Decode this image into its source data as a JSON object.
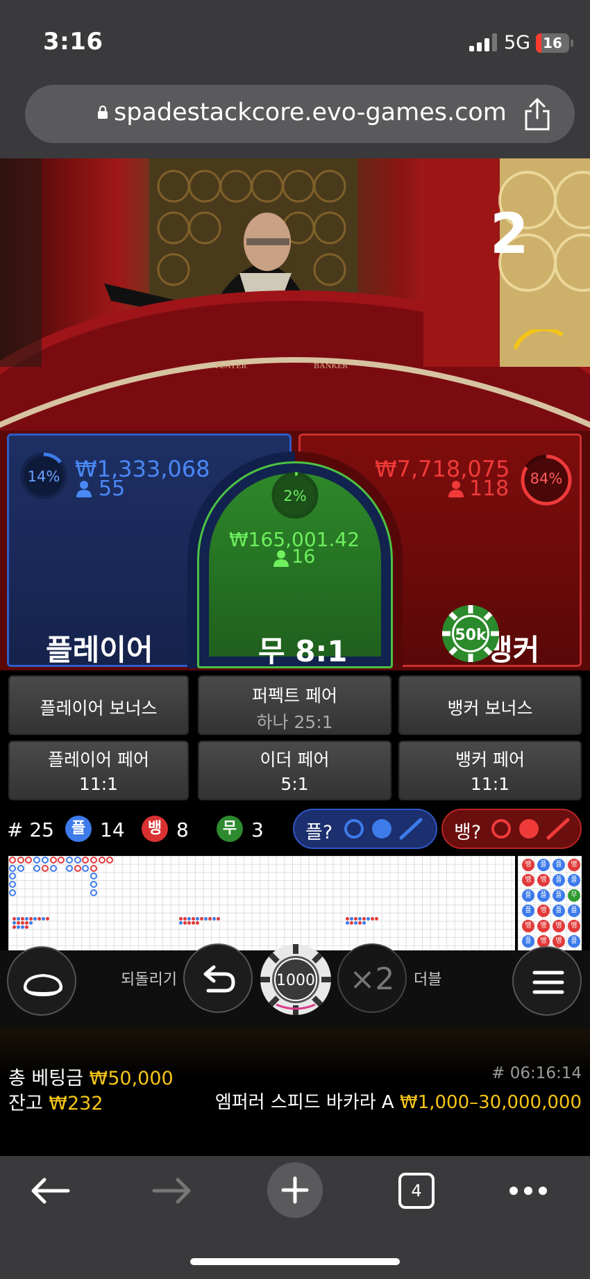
{
  "status_bar": {
    "time": "3:16",
    "network": "5G",
    "battery": "16"
  },
  "browser": {
    "url": "spadestackcore.evo-games.com",
    "tabs_count": "4"
  },
  "video": {
    "round_number": "2"
  },
  "bets": {
    "player": {
      "label": "플레이어",
      "percent": "14%",
      "percent_value": 14,
      "amount": "₩1,333,068",
      "players": "55",
      "color": "#3d7bea"
    },
    "tie": {
      "label": "무 8:1",
      "percent": "2%",
      "percent_value": 2,
      "amount": "₩165,001.42",
      "players": "16",
      "color": "#5ee04f"
    },
    "banker": {
      "label": "뱅커",
      "percent": "84%",
      "percent_value": 84,
      "amount": "₩7,718,075",
      "players": "118",
      "color": "#f03a3a"
    },
    "placed_chip": "50k"
  },
  "side_bets": {
    "player_bonus": "플레이어 보너스",
    "perfect_pair": {
      "label": "퍼펙트 페어",
      "odds": "하나 25:1"
    },
    "banker_bonus": "뱅커 보너스",
    "player_pair": {
      "label": "플레이어 페어",
      "odds": "11:1"
    },
    "either_pair": {
      "label": "이더 페어",
      "odds": "5:1"
    },
    "banker_pair": {
      "label": "뱅커 페어",
      "odds": "11:1"
    }
  },
  "stats": {
    "rounds": "# 25",
    "player_badge": "플",
    "player_count": "14",
    "banker_badge": "뱅",
    "banker_count": "8",
    "tie_badge": "무",
    "tie_count": "3",
    "player_predict": "플?",
    "banker_predict": "뱅?"
  },
  "roadmap_side": [
    "뱅",
    "뱅",
    "플",
    "플",
    "뱅",
    "플",
    "플",
    "뱅",
    "플",
    "뱅",
    "뱅",
    "뱅",
    "플",
    "플",
    "플",
    "플",
    "뱅",
    "뱅",
    "뱅",
    "플",
    "무",
    "플",
    "뱅",
    "플"
  ],
  "controls": {
    "undo_label": "되돌리기",
    "chip_value": "1000",
    "double_symbol": "×2",
    "double_label": "더블"
  },
  "footer": {
    "total_bet_label": "총 베팅금",
    "total_bet_value": "₩50,000",
    "balance_label": "잔고",
    "balance_value": "₩232",
    "round_id": "# 06:16:14",
    "table_name": "엠퍼러 스피드 바카라 A",
    "limits": "₩1,000–30,000,000"
  }
}
